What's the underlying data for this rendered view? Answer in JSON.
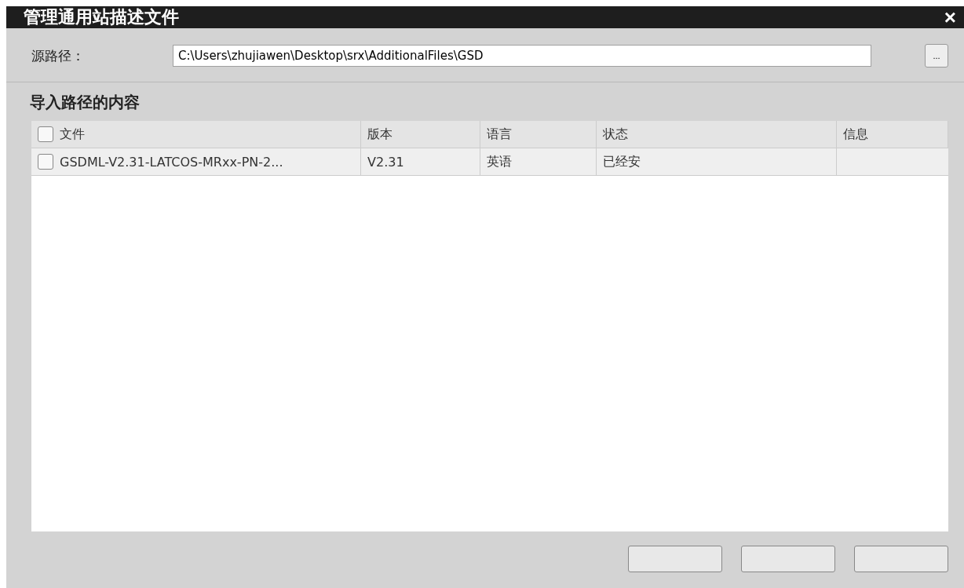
{
  "window": {
    "title": "管理通用站描述文件",
    "close": "×"
  },
  "source": {
    "label": "源路径：",
    "value": "C:\\Users\\zhujiawen\\Desktop\\srx\\AdditionalFiles\\GSD",
    "browse": "..."
  },
  "section_title": "导入路径的内容",
  "table": {
    "select_all_checked": false,
    "columns": [
      "文件",
      "版本",
      "语言",
      "状态",
      "信息"
    ],
    "rows": [
      {
        "checked": false,
        "cells": [
          "GSDML-V2.31-LATCOS-MRxx-PN-2...",
          "V2.31",
          "英语",
          "已经安"
        ]
      }
    ]
  }
}
